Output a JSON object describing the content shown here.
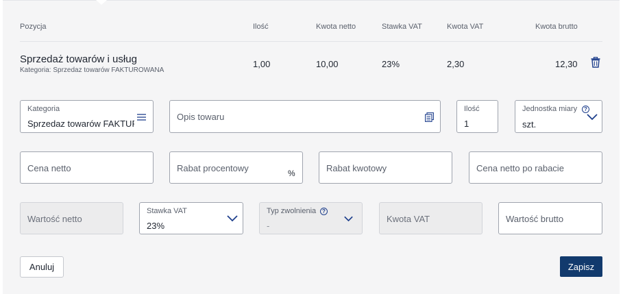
{
  "table": {
    "headers": {
      "pozycja": "Pozycja",
      "ilosc": "Ilość",
      "kwota_netto": "Kwota netto",
      "stawka_vat": "Stawka VAT",
      "kwota_vat": "Kwota VAT",
      "kwota_brutto": "Kwota brutto"
    },
    "row": {
      "name": "Sprzedaż towarów i usług",
      "category": "Kategoria: Sprzedaz towarów FAKTUROWANA",
      "ilosc": "1,00",
      "kwota_netto": "10,00",
      "stawka_vat": "23%",
      "kwota_vat": "2,30",
      "kwota_brutto": "12,30"
    }
  },
  "form": {
    "kategoria": {
      "label": "Kategoria",
      "value": "Sprzedaz towarów FAKTUROWANA"
    },
    "opis": {
      "placeholder": "Opis towaru"
    },
    "ilosc": {
      "label": "Ilość",
      "value": "1"
    },
    "jednostka": {
      "label": "Jednostka miary",
      "value": "szt."
    },
    "cena_netto": {
      "placeholder": "Cena netto"
    },
    "rabat_procentowy": {
      "placeholder": "Rabat procentowy",
      "suffix": "%"
    },
    "rabat_kwotowy": {
      "placeholder": "Rabat kwotowy"
    },
    "cena_po_rabacie": {
      "placeholder": "Cena netto po rabacie"
    },
    "wartosc_netto": {
      "placeholder": "Wartość netto"
    },
    "stawka_vat": {
      "label": "Stawka VAT",
      "value": "23%"
    },
    "typ_zwolnienia": {
      "label": "Typ zwolnienia",
      "value": "-"
    },
    "kwota_vat": {
      "placeholder": "Kwota VAT"
    },
    "wartosc_brutto": {
      "placeholder": "Wartość brutto"
    }
  },
  "buttons": {
    "cancel": "Anuluj",
    "save": "Zapisz"
  },
  "icons": {
    "info_glyph": "?",
    "trash": "trash-icon",
    "menu": "menu-lines-icon",
    "catalog": "catalog-icon",
    "chevron": "chevron-down-icon"
  },
  "colors": {
    "primary": "#123a6d",
    "accent": "#1e3f8c",
    "panel": "#f5f5f6"
  }
}
